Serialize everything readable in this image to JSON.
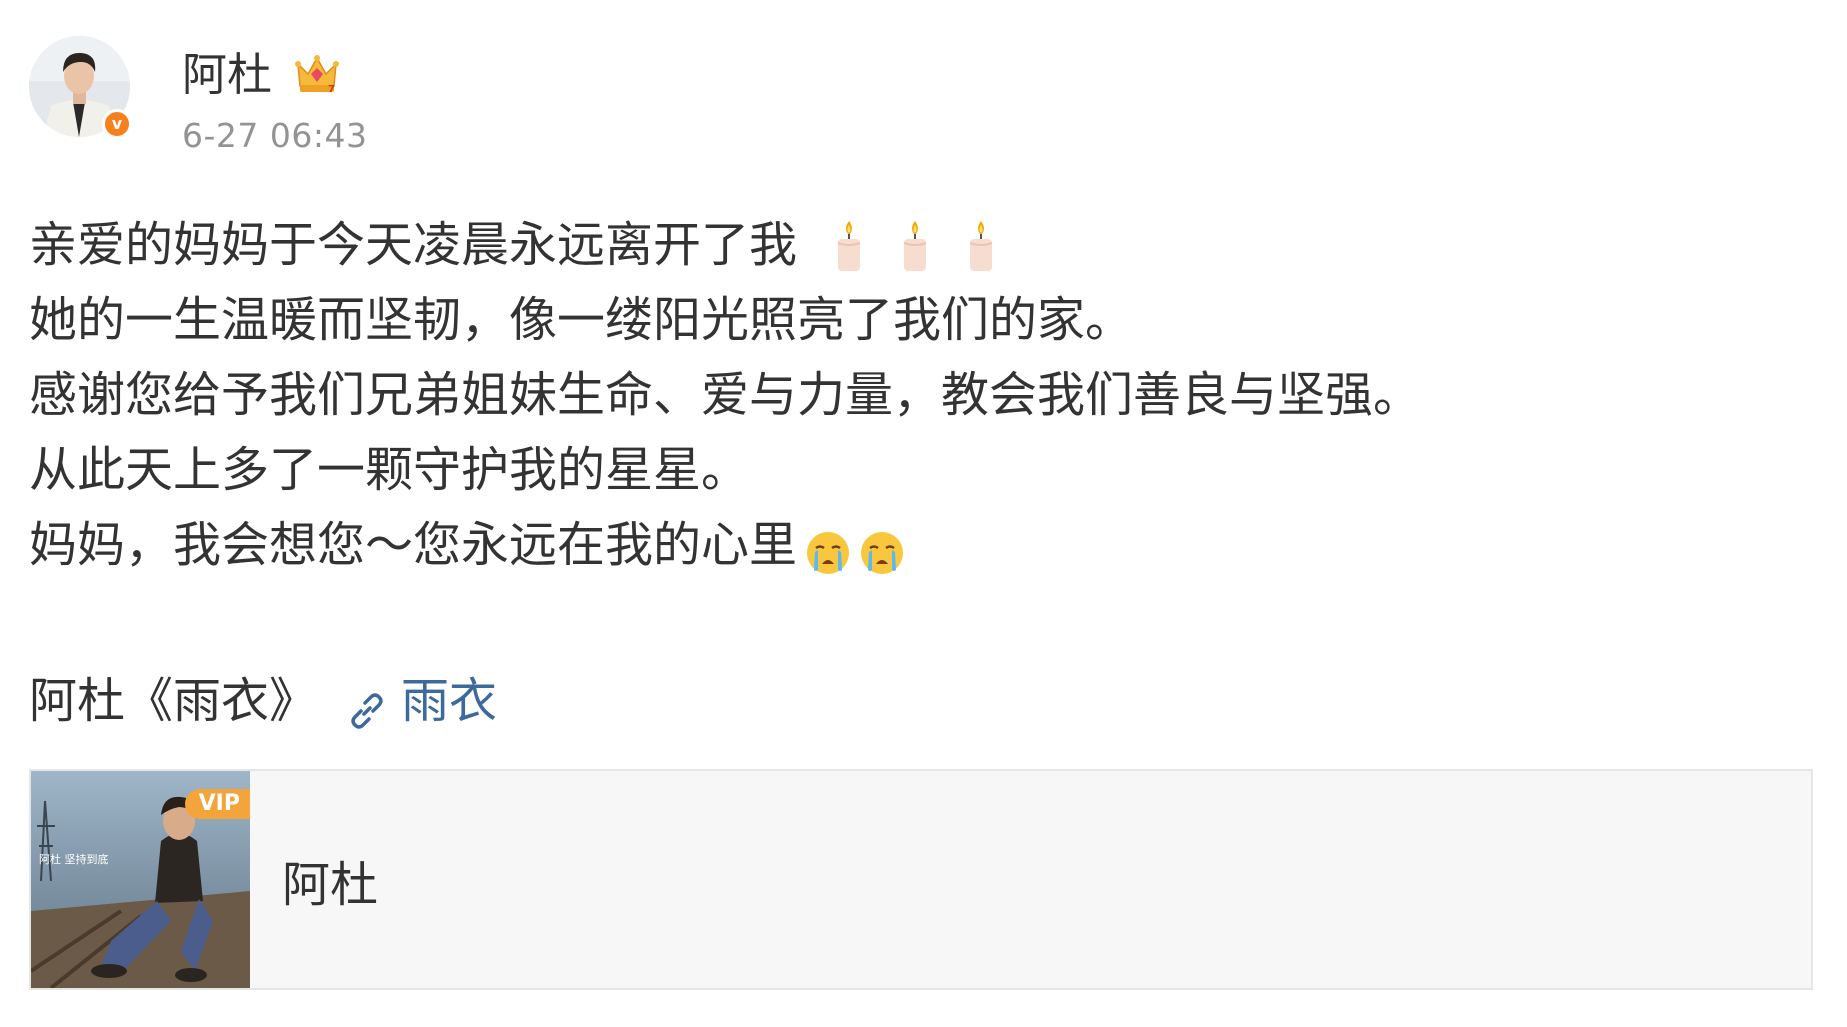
{
  "post": {
    "author": "阿杜",
    "time": "6-27 06:43",
    "lines": [
      "亲爱的妈妈于今天凌晨永远离开了我",
      "她的一生温暖而坚韧，像一缕阳光照亮了我们的家。",
      "感谢您给予我们兄弟姐妹生命、爱与力量，教会我们善良与坚强。",
      "从此天上多了一颗守护我的星星。",
      "妈妈，我会想您～您永远在我的心里"
    ],
    "music_line": {
      "text": "阿杜《雨衣》",
      "link_label": "雨衣"
    },
    "icons": {
      "badge": "verified-v-icon",
      "member": "crown-icon",
      "candles": "candle-icon",
      "crying": "crying-face-icon",
      "link": "link-icon"
    }
  },
  "music_card": {
    "vip_label": "VIP",
    "cover_text": "阿杜 坚持到底",
    "artist": "阿杜"
  },
  "colors": {
    "link": "#3d6a9c",
    "time": "#939393",
    "verified": "#f7801e",
    "vip": "#f3a43a",
    "card_bg": "#f7f7f7"
  }
}
